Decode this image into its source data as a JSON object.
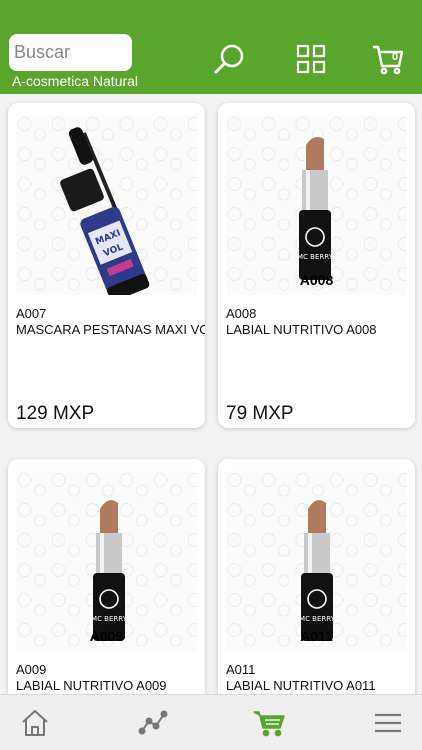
{
  "header": {
    "search_placeholder": "Buscar",
    "brand": "A-cosmetica Natural",
    "cart_count": "0",
    "icons": [
      "search-icon",
      "grid-icon",
      "cart-icon"
    ]
  },
  "products": [
    {
      "code": "A007",
      "name": "MASCARA PESTANAS MAXI VO",
      "price": "129 MXP",
      "image": "mascara"
    },
    {
      "code": "A008",
      "name": "LABIAL NUTRITIVO A008",
      "price": "79 MXP",
      "image": "lipstick",
      "label": "A008"
    },
    {
      "code": "A009",
      "name": "LABIAL NUTRITIVO A009",
      "price": "",
      "image": "lipstick",
      "label": "A009"
    },
    {
      "code": "A011",
      "name": "LABIAL NUTRITIVO A011",
      "price": "",
      "image": "lipstick",
      "label": "A011"
    }
  ],
  "bottom_nav": {
    "items": [
      "home-icon",
      "stats-icon",
      "cart-icon",
      "menu-icon"
    ],
    "active": "cart-icon"
  },
  "colors": {
    "header": "#5aa52b",
    "active_nav": "#5aa52b",
    "lipstick": "#b07a5e"
  }
}
